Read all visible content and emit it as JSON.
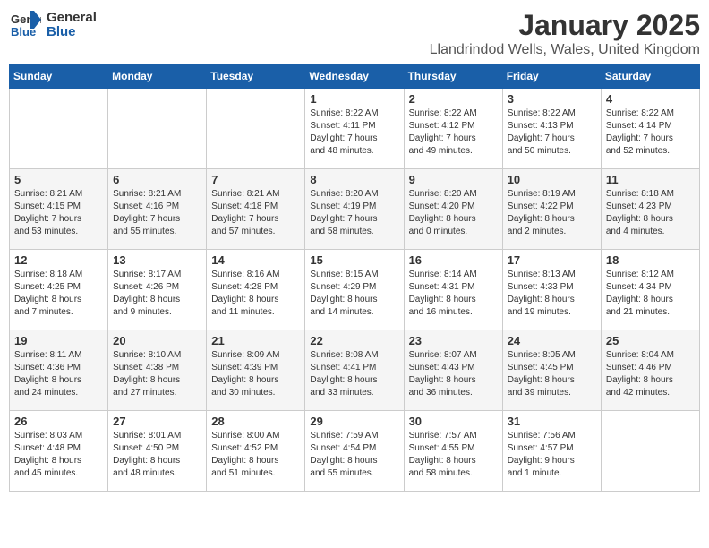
{
  "logo": {
    "general": "General",
    "blue": "Blue"
  },
  "title": "January 2025",
  "subtitle": "Llandrindod Wells, Wales, United Kingdom",
  "days_header": [
    "Sunday",
    "Monday",
    "Tuesday",
    "Wednesday",
    "Thursday",
    "Friday",
    "Saturday"
  ],
  "weeks": [
    [
      {
        "day": "",
        "info": ""
      },
      {
        "day": "",
        "info": ""
      },
      {
        "day": "",
        "info": ""
      },
      {
        "day": "1",
        "info": "Sunrise: 8:22 AM\nSunset: 4:11 PM\nDaylight: 7 hours\nand 48 minutes."
      },
      {
        "day": "2",
        "info": "Sunrise: 8:22 AM\nSunset: 4:12 PM\nDaylight: 7 hours\nand 49 minutes."
      },
      {
        "day": "3",
        "info": "Sunrise: 8:22 AM\nSunset: 4:13 PM\nDaylight: 7 hours\nand 50 minutes."
      },
      {
        "day": "4",
        "info": "Sunrise: 8:22 AM\nSunset: 4:14 PM\nDaylight: 7 hours\nand 52 minutes."
      }
    ],
    [
      {
        "day": "5",
        "info": "Sunrise: 8:21 AM\nSunset: 4:15 PM\nDaylight: 7 hours\nand 53 minutes."
      },
      {
        "day": "6",
        "info": "Sunrise: 8:21 AM\nSunset: 4:16 PM\nDaylight: 7 hours\nand 55 minutes."
      },
      {
        "day": "7",
        "info": "Sunrise: 8:21 AM\nSunset: 4:18 PM\nDaylight: 7 hours\nand 57 minutes."
      },
      {
        "day": "8",
        "info": "Sunrise: 8:20 AM\nSunset: 4:19 PM\nDaylight: 7 hours\nand 58 minutes."
      },
      {
        "day": "9",
        "info": "Sunrise: 8:20 AM\nSunset: 4:20 PM\nDaylight: 8 hours\nand 0 minutes."
      },
      {
        "day": "10",
        "info": "Sunrise: 8:19 AM\nSunset: 4:22 PM\nDaylight: 8 hours\nand 2 minutes."
      },
      {
        "day": "11",
        "info": "Sunrise: 8:18 AM\nSunset: 4:23 PM\nDaylight: 8 hours\nand 4 minutes."
      }
    ],
    [
      {
        "day": "12",
        "info": "Sunrise: 8:18 AM\nSunset: 4:25 PM\nDaylight: 8 hours\nand 7 minutes."
      },
      {
        "day": "13",
        "info": "Sunrise: 8:17 AM\nSunset: 4:26 PM\nDaylight: 8 hours\nand 9 minutes."
      },
      {
        "day": "14",
        "info": "Sunrise: 8:16 AM\nSunset: 4:28 PM\nDaylight: 8 hours\nand 11 minutes."
      },
      {
        "day": "15",
        "info": "Sunrise: 8:15 AM\nSunset: 4:29 PM\nDaylight: 8 hours\nand 14 minutes."
      },
      {
        "day": "16",
        "info": "Sunrise: 8:14 AM\nSunset: 4:31 PM\nDaylight: 8 hours\nand 16 minutes."
      },
      {
        "day": "17",
        "info": "Sunrise: 8:13 AM\nSunset: 4:33 PM\nDaylight: 8 hours\nand 19 minutes."
      },
      {
        "day": "18",
        "info": "Sunrise: 8:12 AM\nSunset: 4:34 PM\nDaylight: 8 hours\nand 21 minutes."
      }
    ],
    [
      {
        "day": "19",
        "info": "Sunrise: 8:11 AM\nSunset: 4:36 PM\nDaylight: 8 hours\nand 24 minutes."
      },
      {
        "day": "20",
        "info": "Sunrise: 8:10 AM\nSunset: 4:38 PM\nDaylight: 8 hours\nand 27 minutes."
      },
      {
        "day": "21",
        "info": "Sunrise: 8:09 AM\nSunset: 4:39 PM\nDaylight: 8 hours\nand 30 minutes."
      },
      {
        "day": "22",
        "info": "Sunrise: 8:08 AM\nSunset: 4:41 PM\nDaylight: 8 hours\nand 33 minutes."
      },
      {
        "day": "23",
        "info": "Sunrise: 8:07 AM\nSunset: 4:43 PM\nDaylight: 8 hours\nand 36 minutes."
      },
      {
        "day": "24",
        "info": "Sunrise: 8:05 AM\nSunset: 4:45 PM\nDaylight: 8 hours\nand 39 minutes."
      },
      {
        "day": "25",
        "info": "Sunrise: 8:04 AM\nSunset: 4:46 PM\nDaylight: 8 hours\nand 42 minutes."
      }
    ],
    [
      {
        "day": "26",
        "info": "Sunrise: 8:03 AM\nSunset: 4:48 PM\nDaylight: 8 hours\nand 45 minutes."
      },
      {
        "day": "27",
        "info": "Sunrise: 8:01 AM\nSunset: 4:50 PM\nDaylight: 8 hours\nand 48 minutes."
      },
      {
        "day": "28",
        "info": "Sunrise: 8:00 AM\nSunset: 4:52 PM\nDaylight: 8 hours\nand 51 minutes."
      },
      {
        "day": "29",
        "info": "Sunrise: 7:59 AM\nSunset: 4:54 PM\nDaylight: 8 hours\nand 55 minutes."
      },
      {
        "day": "30",
        "info": "Sunrise: 7:57 AM\nSunset: 4:55 PM\nDaylight: 8 hours\nand 58 minutes."
      },
      {
        "day": "31",
        "info": "Sunrise: 7:56 AM\nSunset: 4:57 PM\nDaylight: 9 hours\nand 1 minute."
      },
      {
        "day": "",
        "info": ""
      }
    ]
  ]
}
